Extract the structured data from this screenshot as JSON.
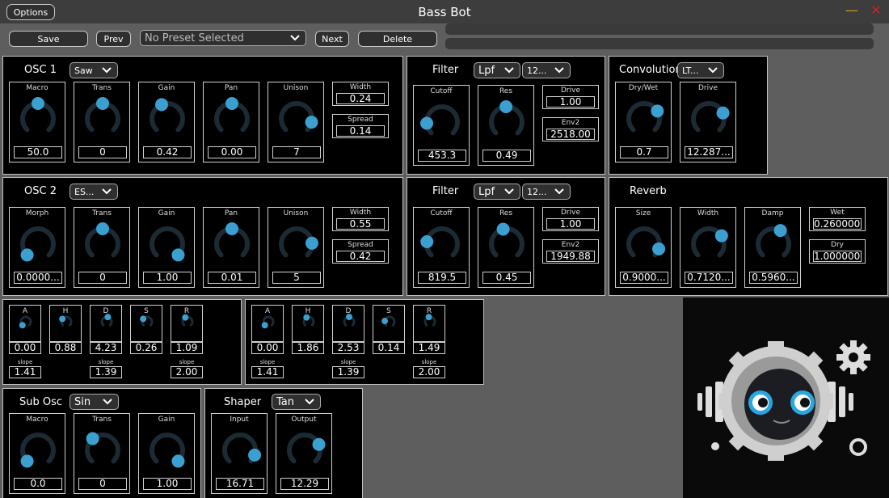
{
  "app": {
    "title": "Bass Bot",
    "options_label": "Options",
    "minimize": "—",
    "close": "✕"
  },
  "toolbar": {
    "save": "Save",
    "prev": "Prev",
    "preset": "No Preset Selected",
    "next": "Next",
    "delete": "Delete"
  },
  "osc1": {
    "title": "OSC 1",
    "wave": "Saw",
    "knobs": [
      {
        "label": "Macro",
        "value": "50.0",
        "level": 0.5
      },
      {
        "label": "Trans",
        "value": "0",
        "level": 0.5
      },
      {
        "label": "Gain",
        "value": "0.42",
        "level": 0.42
      },
      {
        "label": "Pan",
        "value": "0.00",
        "level": 0.5
      },
      {
        "label": "Unison",
        "value": "7",
        "level": 0.88
      }
    ],
    "width_label": "Width",
    "width": "0.24",
    "spread_label": "Spread",
    "spread": "0.14"
  },
  "filter1": {
    "title": "Filter",
    "type": "Lpf",
    "slope": "12...",
    "knobs": [
      {
        "label": "Cutoff",
        "value": "453.3",
        "level": 0.15
      },
      {
        "label": "Res",
        "value": "0.49",
        "level": 0.49
      }
    ],
    "drive_label": "Drive",
    "drive": "1.00",
    "env2_label": "Env2",
    "env2": "2518.00"
  },
  "conv": {
    "title": "Convolution",
    "ir": "LT...",
    "knobs": [
      {
        "label": "Dry/Wet",
        "value": "0.7",
        "level": 0.72
      },
      {
        "label": "Drive",
        "value": "12.287...",
        "level": 0.75
      }
    ]
  },
  "osc2": {
    "title": "OSC 2",
    "wave": "ES...",
    "knobs": [
      {
        "label": "Morph",
        "value": "0.0000...",
        "level": 0.0
      },
      {
        "label": "Trans",
        "value": "0",
        "level": 0.5
      },
      {
        "label": "Gain",
        "value": "1.00",
        "level": 1.0
      },
      {
        "label": "Pan",
        "value": "0.01",
        "level": 0.5
      },
      {
        "label": "Unison",
        "value": "5",
        "level": 0.82
      }
    ],
    "width_label": "Width",
    "width": "0.55",
    "spread_label": "Spread",
    "spread": "0.42"
  },
  "filter2": {
    "title": "Filter",
    "type": "Lpf",
    "slope": "12...",
    "knobs": [
      {
        "label": "Cutoff",
        "value": "819.5",
        "level": 0.2
      },
      {
        "label": "Res",
        "value": "0.45",
        "level": 0.45
      }
    ],
    "drive_label": "Drive",
    "drive": "1.00",
    "env2_label": "Env2",
    "env2": "1949.88"
  },
  "reverb": {
    "title": "Reverb",
    "knobs": [
      {
        "label": "Size",
        "value": "0.9000...",
        "level": 0.9
      },
      {
        "label": "Width",
        "value": "0.7120...",
        "level": 0.71
      },
      {
        "label": "Damp",
        "value": "0.5960...",
        "level": 0.6
      }
    ],
    "wet_label": "Wet",
    "wet": "0.2600000",
    "dry_label": "Dry",
    "dry": "1.0000000"
  },
  "env1": {
    "knobs": [
      {
        "label": "A",
        "value": "0.00",
        "level": 0.0
      },
      {
        "label": "H",
        "value": "0.88",
        "level": 0.3
      },
      {
        "label": "D",
        "value": "4.23",
        "level": 0.55
      },
      {
        "label": "S",
        "value": "0.26",
        "level": 0.3
      },
      {
        "label": "R",
        "value": "1.09",
        "level": 0.4
      }
    ],
    "slopes": [
      {
        "label": "slope",
        "value": "1.41"
      },
      {
        "label": "slope",
        "value": "1.39"
      },
      {
        "label": "slope",
        "value": "2.00"
      }
    ]
  },
  "env2": {
    "knobs": [
      {
        "label": "A",
        "value": "0.00",
        "level": 0.0
      },
      {
        "label": "H",
        "value": "1.86",
        "level": 0.4
      },
      {
        "label": "D",
        "value": "2.53",
        "level": 0.5
      },
      {
        "label": "S",
        "value": "0.14",
        "level": 0.2
      },
      {
        "label": "R",
        "value": "1.49",
        "level": 0.45
      }
    ],
    "slopes": [
      {
        "label": "slope",
        "value": "1.41"
      },
      {
        "label": "slope",
        "value": "1.39"
      },
      {
        "label": "slope",
        "value": "2.00"
      }
    ]
  },
  "subosc": {
    "title": "Sub Osc",
    "wave": "Sin",
    "knobs": [
      {
        "label": "Macro",
        "value": "0.0",
        "level": 0.0
      },
      {
        "label": "Trans",
        "value": "0",
        "level": 0.35
      },
      {
        "label": "Gain",
        "value": "1.00",
        "level": 1.0
      }
    ]
  },
  "shaper": {
    "title": "Shaper",
    "curve": "Tan",
    "knobs": [
      {
        "label": "Input",
        "value": "16.71",
        "level": 0.9
      },
      {
        "label": "Output",
        "value": "12.29",
        "level": 0.75
      }
    ]
  },
  "colors": {
    "accent": "#3b9fd0",
    "track": "#1c2a34",
    "panel": "#000000",
    "background": "#5e5e5e"
  }
}
